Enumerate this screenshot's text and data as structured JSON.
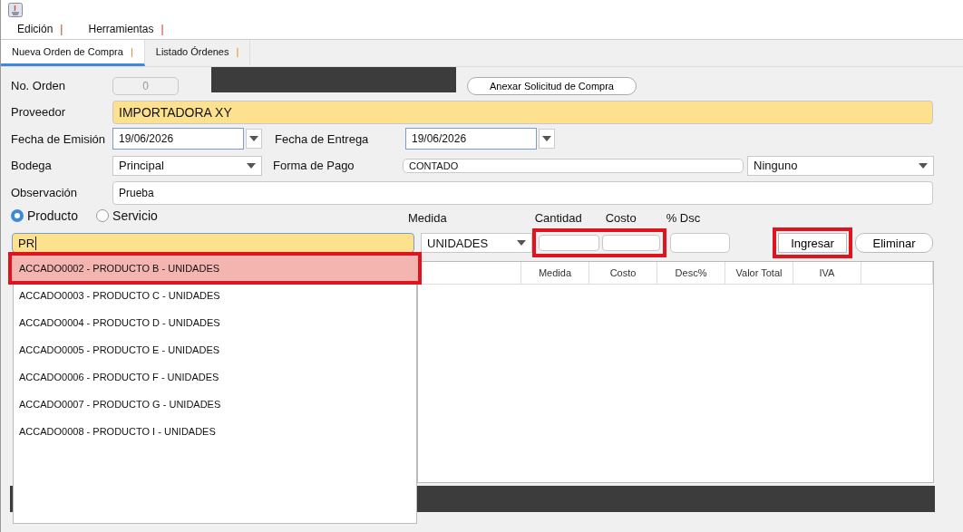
{
  "menu": [
    {
      "label": "Edición",
      "mark": "|"
    },
    {
      "label": "Herramientas",
      "mark": "|"
    }
  ],
  "tabs": [
    {
      "label": "Nueva Orden de Compra",
      "mark": "|",
      "selected": true
    },
    {
      "label": "Listado Órdenes",
      "mark": "|",
      "selected": false
    }
  ],
  "order_no": {
    "label": "No. Orden",
    "value": "0",
    "disabled": true
  },
  "attach_button": "Anexar Solicitud de Compra",
  "supplier": {
    "label": "Proveedor",
    "value": "IMPORTADORA XY"
  },
  "issue_date": {
    "label": "Fecha de Emisión",
    "value": "19/06/2026"
  },
  "delivery_date": {
    "label": "Fecha de Entrega",
    "value": "19/06/2026"
  },
  "warehouse": {
    "label": "Bodega",
    "value": "Principal"
  },
  "payment": {
    "label": "Forma de Pago",
    "value": "CONTADO",
    "option": "Ninguno"
  },
  "observation": {
    "label": "Observación",
    "value": "Prueba"
  },
  "item_type": [
    {
      "label": "Producto",
      "selected": true
    },
    {
      "label": "Servicio",
      "selected": false
    }
  ],
  "search": {
    "value": "PR"
  },
  "measure": {
    "label": "Medida",
    "value": "UNIDADES"
  },
  "amounts": {
    "highlighted": true,
    "fields": [
      {
        "label": "Cantidad"
      },
      {
        "label": "Costo"
      }
    ]
  },
  "discount": {
    "label": "% Dsc"
  },
  "buttons": [
    {
      "label": "Ingresar",
      "highlighted": true
    },
    {
      "label": "Eliminar",
      "highlighted": false
    }
  ],
  "table": {
    "columns": [
      "Medida",
      "Costo",
      "Desc%",
      "Valor Total",
      "IVA"
    ]
  },
  "suggestions": [
    {
      "label": "ACCADO0002 - PRODUCTO B - UNIDADES",
      "selected": true,
      "highlighted": true
    },
    {
      "label": "ACCADO0003 - PRODUCTO C - UNIDADES",
      "selected": false,
      "highlighted": false
    },
    {
      "label": "ACCADO0004 - PRODUCTO D - UNIDADES",
      "selected": false,
      "highlighted": false
    },
    {
      "label": "ACCADO0005 - PRODUCTO E - UNIDADES",
      "selected": false,
      "highlighted": false
    },
    {
      "label": "ACCADO0006 - PRODUCTO F - UNIDADES",
      "selected": false,
      "highlighted": false
    },
    {
      "label": "ACCADO0007 - PRODUCTO G - UNIDADES",
      "selected": false,
      "highlighted": false
    },
    {
      "label": "ACCADO0008 - PRODUCTO I - UNIDADES",
      "selected": false,
      "highlighted": false
    }
  ]
}
